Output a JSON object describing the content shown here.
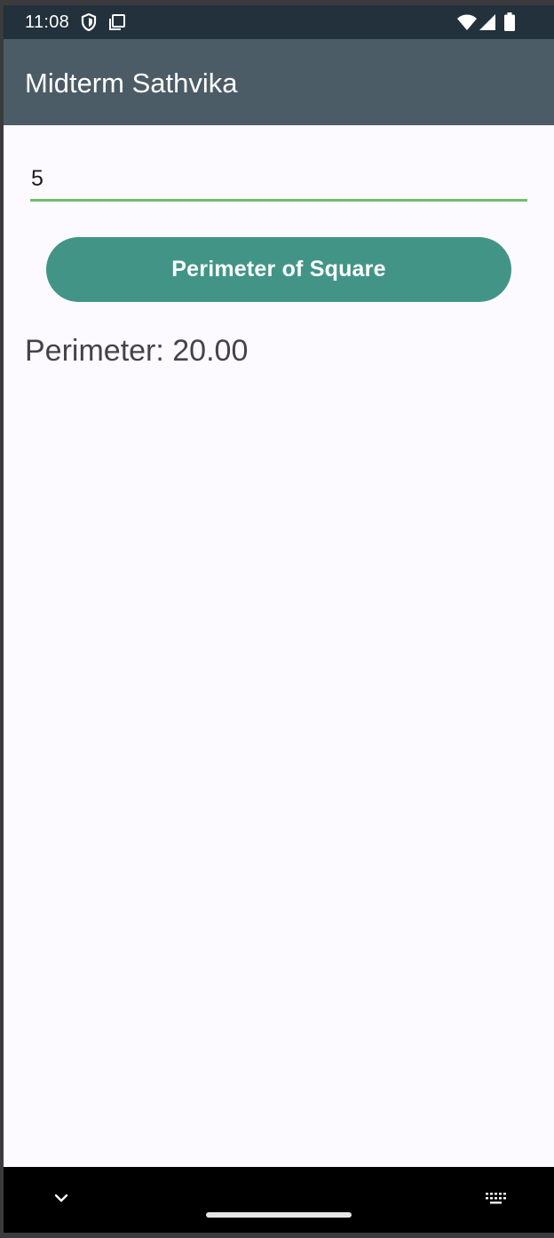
{
  "status_bar": {
    "time": "11:08",
    "icons": [
      "shield-icon",
      "screenshot-icon",
      "wifi-icon",
      "cell-signal-icon",
      "battery-icon"
    ]
  },
  "app_bar": {
    "title": "Midterm Sathvika",
    "background": "#4c5c66"
  },
  "form": {
    "input_value": "5",
    "underline_color": "#6cc070",
    "button_label": "Perimeter of Square",
    "button_color": "#429586",
    "result_text": "Perimeter: 20.00"
  },
  "nav_bar": {
    "icons": [
      "chevron-down-icon",
      "keyboard-icon"
    ]
  }
}
